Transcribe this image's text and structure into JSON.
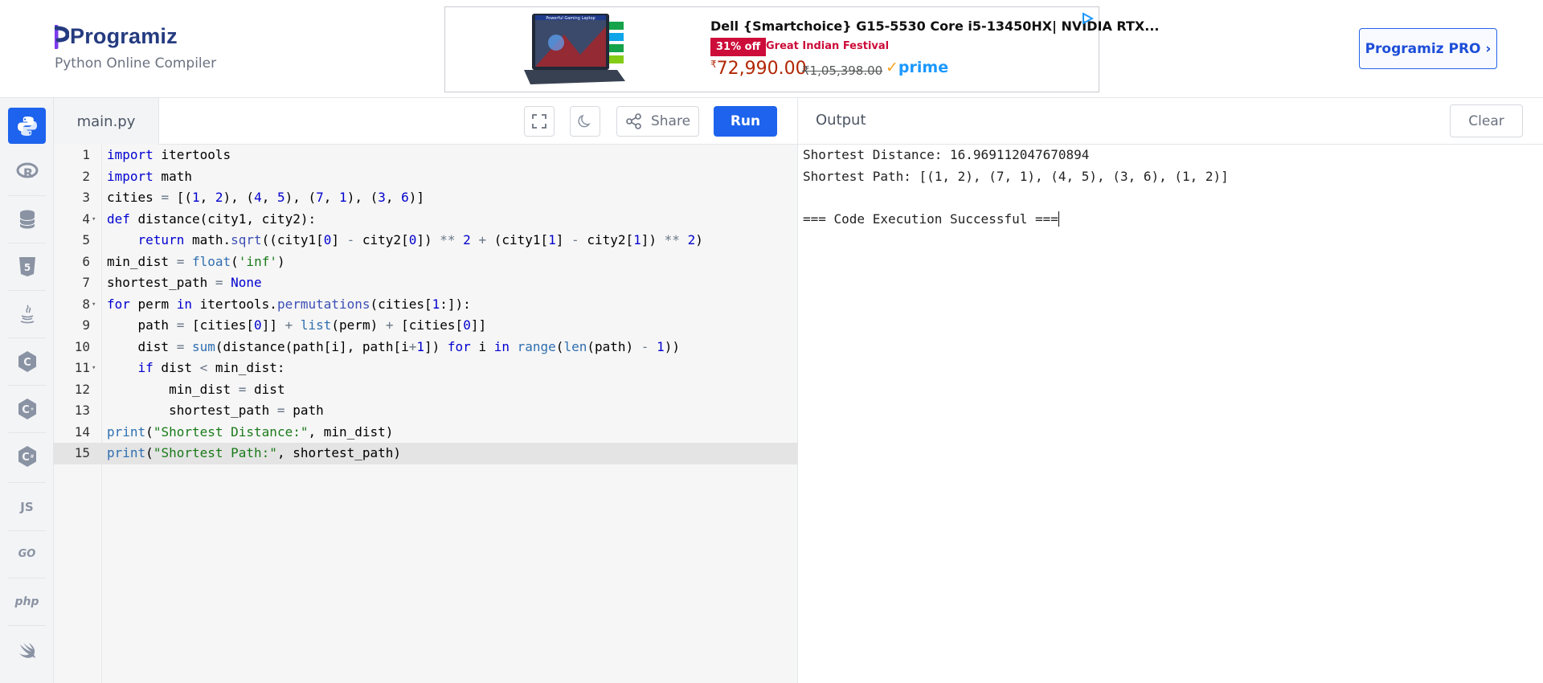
{
  "header": {
    "brand": "Programiz",
    "tagline": "Python Online Compiler",
    "pro_button": "Programiz PRO ›"
  },
  "ad": {
    "title": "Dell {Smartchoice} G15-5530 Core i5-13450HX| NVIDIA RTX...",
    "badge": "31% off",
    "festival": "Great Indian Festival",
    "currency": "₹",
    "price": "72,990.00",
    "mrp": "₹1,05,398.00",
    "prime": "prime",
    "image_caption": "Powerful Gaming Laptop"
  },
  "sidebar": {
    "items": [
      {
        "name": "python",
        "active": true
      },
      {
        "name": "r"
      },
      {
        "name": "sql"
      },
      {
        "name": "html5"
      },
      {
        "name": "java"
      },
      {
        "name": "c"
      },
      {
        "name": "cpp"
      },
      {
        "name": "csharp"
      },
      {
        "name": "js",
        "label": "JS"
      },
      {
        "name": "go",
        "label": "GO"
      },
      {
        "name": "php",
        "label": "php"
      },
      {
        "name": "swift"
      }
    ]
  },
  "editor": {
    "file_name": "main.py",
    "share_label": "Share",
    "run_label": "Run",
    "active_line": 15,
    "lines": [
      "import itertools",
      "import math",
      "cities = [(1, 2), (4, 5), (7, 1), (3, 6)]",
      "def distance(city1, city2):",
      "    return math.sqrt((city1[0] - city2[0]) ** 2 + (city1[1] - city2[1]) ** 2)",
      "min_dist = float('inf')",
      "shortest_path = None",
      "for perm in itertools.permutations(cities[1:]):",
      "    path = [cities[0]] + list(perm) + [cities[0]]",
      "    dist = sum(distance(path[i], path[i+1]) for i in range(len(path) - 1))",
      "    if dist < min_dist:",
      "        min_dist = dist",
      "        shortest_path = path",
      "print(\"Shortest Distance:\", min_dist)",
      "print(\"Shortest Path:\", shortest_path)"
    ],
    "fold_lines": [
      4,
      8,
      11
    ]
  },
  "output": {
    "title": "Output",
    "clear_label": "Clear",
    "lines": [
      "Shortest Distance: 16.969112047670894",
      "Shortest Path: [(1, 2), (7, 1), (4, 5), (3, 6), (1, 2)]",
      "",
      "=== Code Execution Successful ==="
    ]
  },
  "colors": {
    "accent": "#1d63ed",
    "brand": "#253b80",
    "ad_badge": "#cc0c39",
    "price": "#b12704",
    "prime": "#1a98ff"
  }
}
